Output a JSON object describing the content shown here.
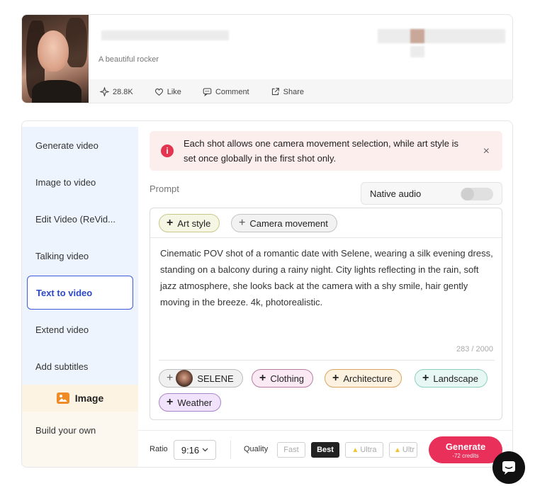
{
  "profile": {
    "subtitle": "A beautiful rocker",
    "stats": {
      "views": "28.8K",
      "like_label": "Like",
      "comment_label": "Comment",
      "share_label": "Share"
    }
  },
  "sidebar": {
    "items": [
      {
        "label": "Generate video"
      },
      {
        "label": "Image to video"
      },
      {
        "label": "Edit Video (ReVid..."
      },
      {
        "label": "Talking video"
      },
      {
        "label": "Text to video"
      },
      {
        "label": "Extend video"
      },
      {
        "label": "Add subtitles"
      }
    ],
    "active": "Text to video",
    "group_label": "Image",
    "image_items": [
      {
        "label": "Build your own"
      }
    ]
  },
  "alert": {
    "message": "Each shot allows one camera movement selection, while art style is set once globally in the first shot only.",
    "close": "×"
  },
  "prompt": {
    "label": "Prompt",
    "native_audio_label": "Native audio",
    "native_audio_on": false,
    "chips_top": {
      "art_style": "Art style",
      "camera_movement": "Camera movement"
    },
    "text": "Cinematic POV shot of a romantic date with Selene, wearing a silk evening dress, standing on a balcony during a rainy night. City lights reflecting in the rain, soft jazz atmosphere, she looks back at the camera with a shy smile, hair gently moving in the breeze. 4k, photorealistic.",
    "counter": "283 / 2000",
    "tags": {
      "selene": "SELENE",
      "clothing": "Clothing",
      "architecture": "Architecture",
      "landscape": "Landscape",
      "weather": "Weather"
    }
  },
  "bottom": {
    "ratio_label": "Ratio",
    "ratio_value": "9:16",
    "quality_label": "Quality",
    "quality_options": {
      "fast": "Fast",
      "best": "Best",
      "ultra": "Ultra",
      "ultra2": "Ultr"
    },
    "quality_selected": "Best",
    "generate_label": "Generate",
    "generate_credits": "-72 credits"
  },
  "colors": {
    "accent": "#e8305a",
    "active_nav": "#2c48c5",
    "sidebar_bg": "#eef4fd"
  }
}
